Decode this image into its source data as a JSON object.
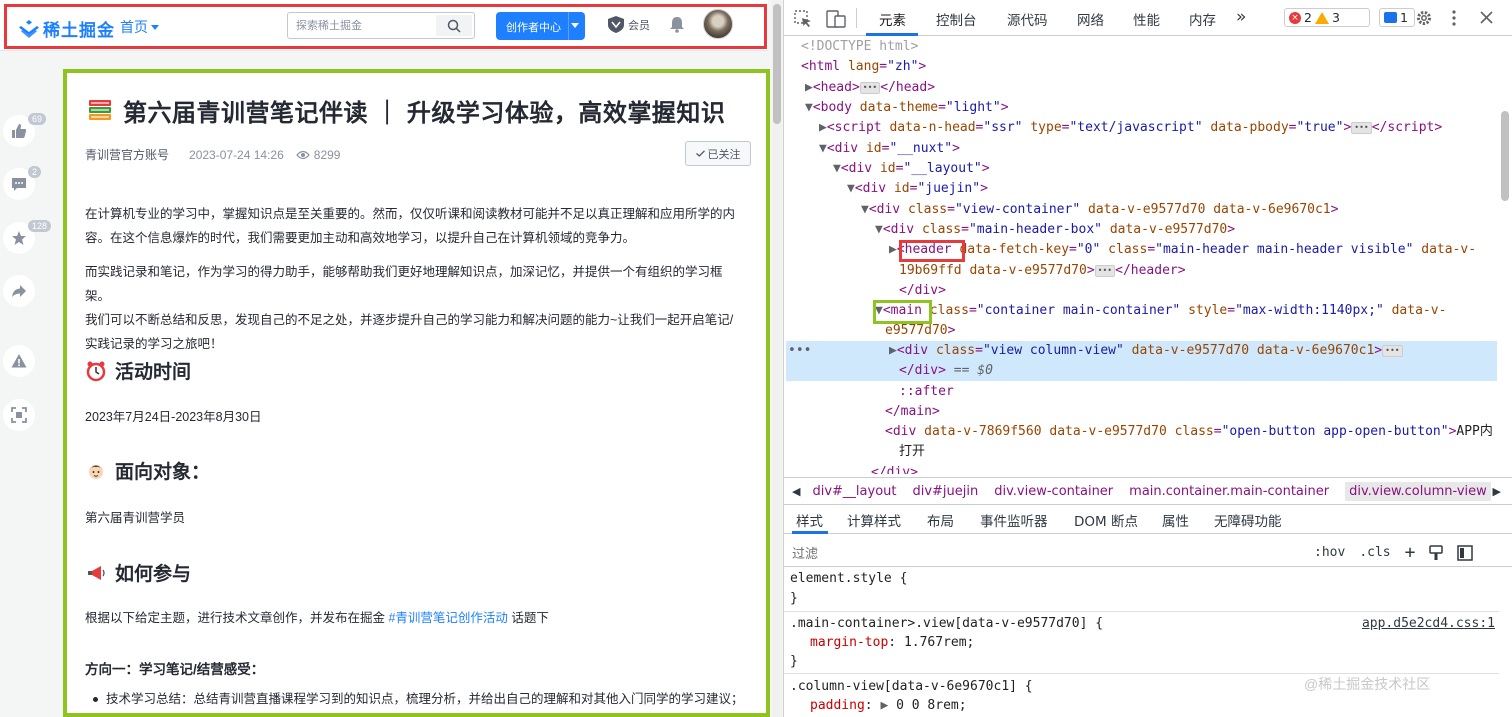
{
  "site": {
    "logo_text": "稀土掘金",
    "nav_home": "首页",
    "search_placeholder": "探索稀土掘金",
    "creator_btn": "创作者中心",
    "vip_label": "会员"
  },
  "sidebar": {
    "like_count": "69",
    "comment_count": "2",
    "collect_count": "128"
  },
  "article": {
    "title": "第六届青训营笔记伴读 ｜ 升级学习体验，高效掌握知识",
    "author": "青训营官方账号",
    "date": "2023-07-24 14:26",
    "views": "8299",
    "follow_label": "已关注",
    "p1_line1": "在计算机专业的学习中，掌握知识点是至关重要的。然而，仅仅听课和阅读教材可能并不足以真正理解和应用所学的内",
    "p1_line2": "容。在这个信息爆炸的时代，我们需要更加主动和高效地学习，以提升自己在计算机领域的竞争力。",
    "p2_line1": "而实践记录和笔记，作为学习的得力助手，能够帮助我们更好地理解知识点，加深记忆，并提供一个有组织的学习框架。",
    "p2_line2": "我们可以不断总结和反思，发现自己的不足之处，并逐步提升自己的学习能力和解决问题的能力~让我们一起开启笔记/",
    "p2_line3": "实践记录的学习之旅吧！",
    "h_time": "活动时间",
    "time_text": "2023年7月24日-2023年8月30日",
    "h_target": "面向对象：",
    "target_text": "第六届青训营学员",
    "h_join": "如何参与",
    "join_prefix": "根据以下给定主题，进行技术文章创作，并发布在掘金 ",
    "join_link": "#青训营笔记创作活动",
    "join_suffix": " 话题下",
    "dir1_title": "方向一：学习笔记/结营感受：",
    "bullet1": "技术学习总结：总结青训营直播课程学习到的知识点，梳理分析，并给出自己的理解和对其他入门同学的学习建议；"
  },
  "devtools": {
    "tabs": [
      "元素",
      "控制台",
      "源代码",
      "网络",
      "性能",
      "内存"
    ],
    "err_count": "2",
    "warn_count": "3",
    "msg_count": "1",
    "lines": {
      "l1": "<!DOCTYPE html>",
      "l2_tag": "html",
      "l2_an": "lang",
      "l2_av": "\"zh\"",
      "l3": "head",
      "l4_tag": "body",
      "l4_an": "data-theme",
      "l4_av": "\"light\"",
      "l5_tag": "script",
      "l5_a1": "data-n-head",
      "l5_v1": "\"ssr\"",
      "l5_a2": "type",
      "l5_v2": "\"text/javascript\"",
      "l5_a3": "data-pbody",
      "l5_v3": "\"true\"",
      "l6_id": "\"__nuxt\"",
      "l7_id": "\"__layout\"",
      "l8_id": "\"juejin\"",
      "l9_class": "\"view-container\"",
      "l9_rest": "data-v-e9577d70 data-v-6e9670c1",
      "l10_class": "\"main-header-box\"",
      "l10_rest": "data-v-e9577d70",
      "l11_tag": "header",
      "l11_a1": "data-fetch-key",
      "l11_v1": "\"0\"",
      "l11_a2": "class",
      "l11_v2": "\"main-header main-header visible\"",
      "l11_a3": "data-v-",
      "l12": "19b69ffd data-v-e9577d70",
      "l14_tag": "main",
      "l14_cls": "\"container main-container\"",
      "l14_style": "\"max-width:1140px;\"",
      "l14_a3": "data-v-",
      "l15": "e9577d70",
      "l16_cls": "\"view column-view\"",
      "l16_rest": "data-v-e9577d70 data-v-6e9670c1",
      "l17_eq": "== $0",
      "l18": "::after",
      "l20_a1": "data-v-7869f560 data-v-e9577d70",
      "l20_cls": "\"open-button app-open-button\"",
      "l20_txt": "APP内",
      "l21": "打开"
    },
    "crumbs": [
      "div#__layout",
      "div#juejin",
      "div.view-container",
      "main.container.main-container",
      "div.view.column-view"
    ],
    "sub_tabs": [
      "样式",
      "计算样式",
      "布局",
      "事件监听器",
      "DOM 断点",
      "属性",
      "无障碍功能"
    ],
    "filter_placeholder": "过滤",
    "hov": ":hov",
    "cls": ".cls",
    "rules": {
      "r1_sel": "element.style {",
      "r1_end": "}",
      "r2_sel": ".main-container>.view[data-v-e9577d70] {",
      "r2_src": "app.d5e2cd4.css:1",
      "r2_prop": "margin-top",
      "r2_val": "1.767rem;",
      "r2_end": "}",
      "r3_sel": ".column-view[data-v-6e9670c1] {",
      "r3_prop": "padding",
      "r3_val": "0 0 8rem;"
    },
    "watermark": "@稀土掘金技术社区"
  }
}
